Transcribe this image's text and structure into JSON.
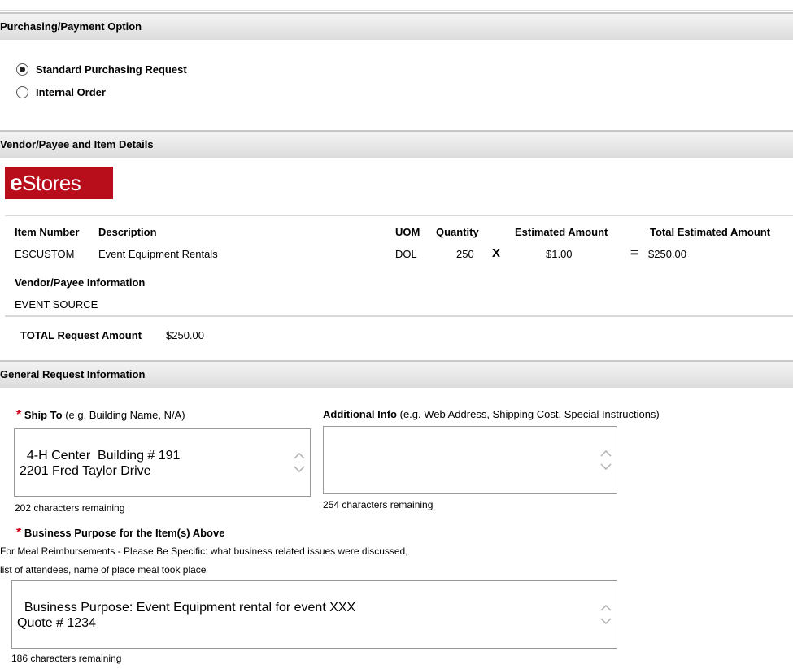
{
  "sections": {
    "purchasing": "Purchasing/Payment Option",
    "vendor": "Vendor/Payee and Item Details",
    "general": "General Request Information"
  },
  "payment_options": [
    {
      "label": "Standard Purchasing Request",
      "selected": true
    },
    {
      "label": "Internal Order",
      "selected": false
    }
  ],
  "logo": {
    "mark": "e",
    "text": "Stores",
    "color": "#b80e1c"
  },
  "items_table": {
    "headers": {
      "item_number": "Item Number",
      "description": "Description",
      "uom": "UOM",
      "quantity": "Quantity",
      "estimated_amount": "Estimated Amount",
      "total_estimated_amount": "Total Estimated Amount"
    },
    "row": {
      "item_number": "ESCUSTOM",
      "description": "Event Equipment Rentals",
      "uom": "DOL",
      "quantity": "250",
      "times": "X",
      "estimated_amount": "$1.00",
      "equals": "=",
      "total": "$250.00"
    }
  },
  "vendor": {
    "label": "Vendor/Payee Information",
    "name": "EVENT SOURCE"
  },
  "total": {
    "label": "TOTAL Request Amount",
    "value": "$250.00"
  },
  "ship_to": {
    "required": "*",
    "label": "Ship To",
    "hint": "(e.g. Building Name, N/A)",
    "value": "4-H Center  Building # 191\n2201 Fred Taylor Drive",
    "remaining": "202 characters remaining"
  },
  "additional_info": {
    "label": "Additional Info",
    "hint": "(e.g. Web Address, Shipping Cost, Special Instructions)",
    "value": "",
    "remaining": "254 characters remaining"
  },
  "business_purpose": {
    "required": "*",
    "label": "Business Purpose for the Item(s) Above",
    "note_line1": "For Meal Reimbursements - Please Be Specific: what business related issues were discussed,",
    "note_line2": "list of attendees, name of place meal took place",
    "value": "Business Purpose: Event Equipment rental for event XXX\nQuote # 1234",
    "remaining": "186 characters remaining"
  }
}
